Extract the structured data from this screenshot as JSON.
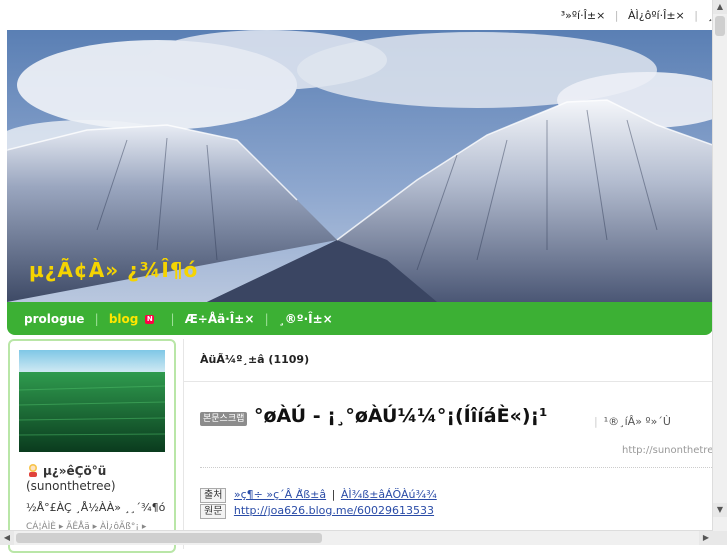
{
  "top_links": [
    "³»ºí·Î±×",
    "ÀÌ¿ôºí·Î±×",
    "¸"
  ],
  "blog_title": "µ¿Ã¢À» ¿¾Î¶ó",
  "nav": {
    "items": [
      "prologue",
      "blog",
      "Æ÷Åä·Î±×",
      "¸®º·Î±×"
    ],
    "badge": "N"
  },
  "profile": {
    "nickname": "µ¿»êÇö°ü",
    "id": "(sunonthetree)",
    "intro": "½Å°£ÀÇ ¸Å½ÀÀ» ¸¸´¾¶ó",
    "menu": "CÁ¦ÀÌÈ ▸  ÃÊÅä ▸  ÀÌ¿ôÃß°¡ ▸"
  },
  "main": {
    "post_count_label": "ÀüÃ¼º¸±â",
    "post_count": "1109",
    "scrap_badge": "본문스크랩",
    "post_title": "°øÀÚ - ¡¸°øÀÚ¼¼°¡(ÍîíáÈ«)¡¹",
    "post_title_extra": "¹®¸íÂ» º»´Ù",
    "post_url": "http://sunonthetree",
    "source_label": "출처",
    "source_link_1": "»ç¶÷ »ç´Â À̾ß±â",
    "source_link_2": "ÀÌ¾ß±âÁÖÀú¾¾",
    "original_label": "원문",
    "original_link": "http://joa626.blog.me/60029613533"
  }
}
